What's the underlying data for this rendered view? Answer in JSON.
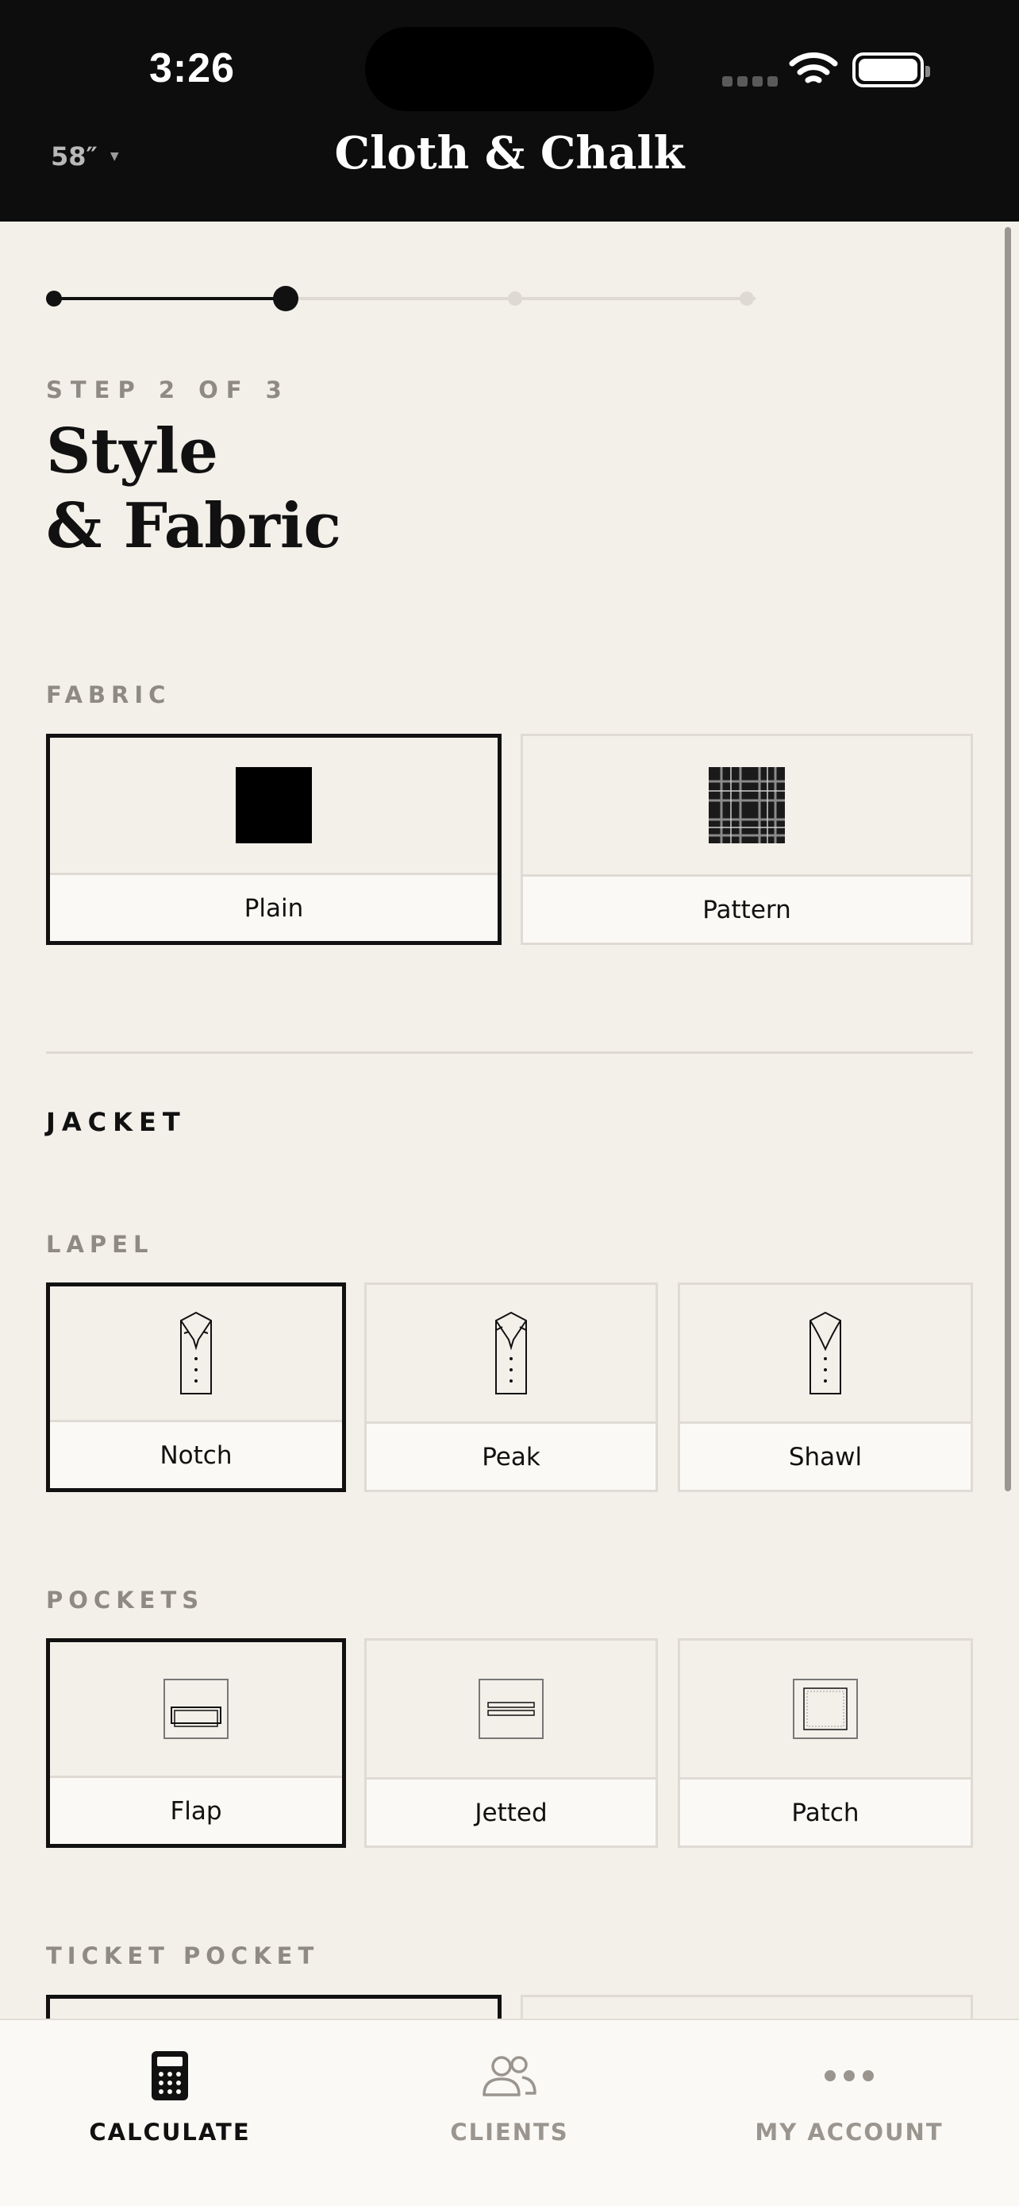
{
  "status_bar": {
    "time": "3:26"
  },
  "header": {
    "size_label": "58″",
    "brand": "Cloth & Chalk"
  },
  "progress": {
    "current_step": 2,
    "total_steps": 4
  },
  "step": {
    "eyebrow": "STEP 2 OF 3",
    "title_line1": "Style",
    "title_line2": "& Fabric"
  },
  "fabric": {
    "label": "FABRIC",
    "options": [
      {
        "label": "Plain",
        "selected": true
      },
      {
        "label": "Pattern",
        "selected": false
      }
    ]
  },
  "jacket": {
    "label": "JACKET",
    "lapel": {
      "label": "LAPEL",
      "options": [
        {
          "label": "Notch",
          "selected": true
        },
        {
          "label": "Peak",
          "selected": false
        },
        {
          "label": "Shawl",
          "selected": false
        }
      ]
    },
    "pockets": {
      "label": "POCKETS",
      "options": [
        {
          "label": "Flap",
          "selected": true
        },
        {
          "label": "Jetted",
          "selected": false
        },
        {
          "label": "Patch",
          "selected": false
        }
      ]
    },
    "ticket_pocket": {
      "label": "TICKET POCKET"
    }
  },
  "tabbar": {
    "items": [
      {
        "label": "CALCULATE",
        "icon": "calculator-icon",
        "active": true
      },
      {
        "label": "CLIENTS",
        "icon": "clients-icon",
        "active": false
      },
      {
        "label": "MY ACCOUNT",
        "icon": "more-icon",
        "active": false
      }
    ]
  },
  "colors": {
    "accent": "#111111",
    "background": "#f3f0ea",
    "header": "#0d0d0d",
    "muted": "#8f8a84"
  }
}
